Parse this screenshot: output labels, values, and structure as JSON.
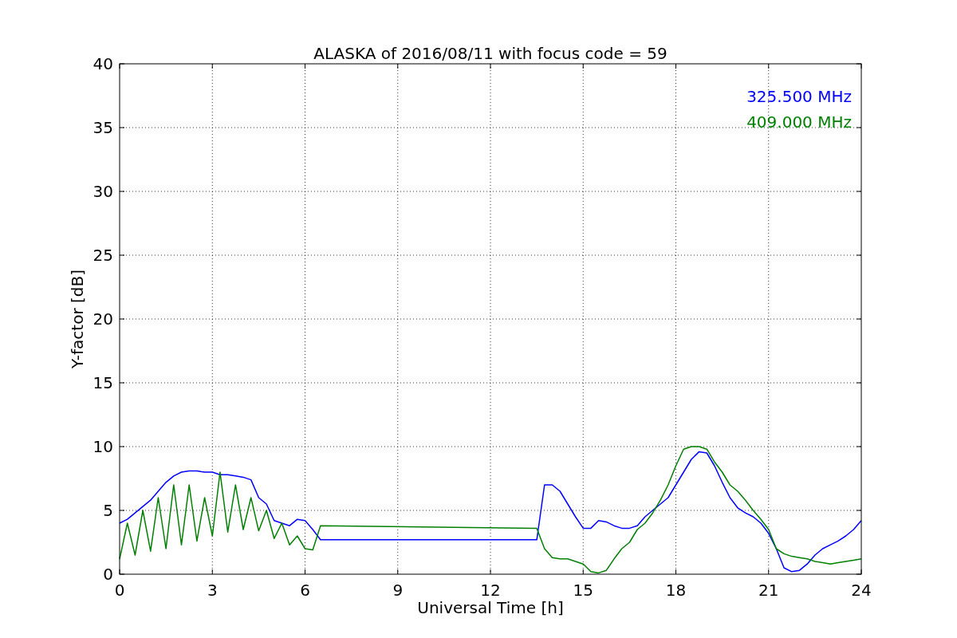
{
  "figure": {
    "chart_data": {
      "type": "line",
      "title": "ALASKA of 2016/08/11 with focus code = 59",
      "xlabel": "Universal Time [h]",
      "ylabel": "Y-factor [dB]",
      "x": [
        0,
        0.25,
        0.5,
        0.75,
        1,
        1.25,
        1.5,
        1.75,
        2,
        2.25,
        2.5,
        2.75,
        3,
        3.25,
        3.5,
        3.75,
        4,
        4.25,
        4.5,
        4.75,
        5,
        5.25,
        5.5,
        5.75,
        6,
        6.25,
        6.5,
        13.5,
        13.75,
        14,
        14.25,
        14.5,
        14.75,
        15,
        15.25,
        15.5,
        15.75,
        16,
        16.25,
        16.5,
        16.75,
        17,
        17.25,
        17.5,
        17.75,
        18,
        18.25,
        18.5,
        18.75,
        19,
        19.25,
        19.5,
        19.75,
        20,
        20.25,
        20.5,
        20.75,
        21,
        21.25,
        21.5,
        21.75,
        22,
        22.25,
        22.5,
        22.75,
        23,
        23.25,
        23.5,
        23.75,
        24
      ],
      "series": [
        {
          "name": "325.500 MHz",
          "color": "#0000ff",
          "values": [
            4,
            4.3,
            4.8,
            5.3,
            5.8,
            6.5,
            7.2,
            7.7,
            8,
            8.1,
            8.1,
            8,
            8,
            7.8,
            7.8,
            7.7,
            7.6,
            7.4,
            6,
            5.5,
            4.2,
            4,
            3.8,
            4.3,
            4.2,
            3.5,
            2.7,
            2.7,
            7,
            7,
            6.5,
            5.5,
            4.5,
            3.6,
            3.6,
            4.2,
            4.1,
            3.8,
            3.6,
            3.6,
            3.8,
            4.5,
            5,
            5.5,
            6,
            7,
            8,
            9,
            9.6,
            9.5,
            8.5,
            7.2,
            6,
            5.2,
            4.8,
            4.5,
            4,
            3.2,
            2,
            0.5,
            0.2,
            0.3,
            0.8,
            1.5,
            2,
            2.3,
            2.6,
            3,
            3.5,
            4.2
          ]
        },
        {
          "name": "409.000 MHz",
          "color": "#008000",
          "values": [
            1.2,
            4,
            1.5,
            5,
            1.8,
            6,
            2,
            7,
            2.3,
            7,
            2.6,
            6,
            3,
            8,
            3.3,
            7,
            3.5,
            6,
            3.4,
            5,
            2.8,
            4,
            2.3,
            3,
            2,
            1.9,
            3.8,
            3.6,
            2,
            1.3,
            1.2,
            1.2,
            1,
            0.8,
            0.2,
            0.1,
            0.3,
            1.2,
            2,
            2.5,
            3.5,
            4,
            4.8,
            5.8,
            7,
            8.5,
            9.8,
            10,
            10,
            9.8,
            8.8,
            8,
            7,
            6.5,
            5.8,
            5,
            4.3,
            3.5,
            2,
            1.6,
            1.4,
            1.3,
            1.2,
            1,
            0.9,
            0.8,
            0.9,
            1,
            1.1,
            1.2
          ]
        }
      ],
      "grid": true,
      "xlim": [
        0,
        24
      ],
      "ylim": [
        0,
        40
      ],
      "xticks": [
        0,
        3,
        6,
        9,
        12,
        15,
        18,
        21,
        24
      ],
      "yticks": [
        0,
        5,
        10,
        15,
        20,
        25,
        30,
        35,
        40
      ]
    }
  }
}
